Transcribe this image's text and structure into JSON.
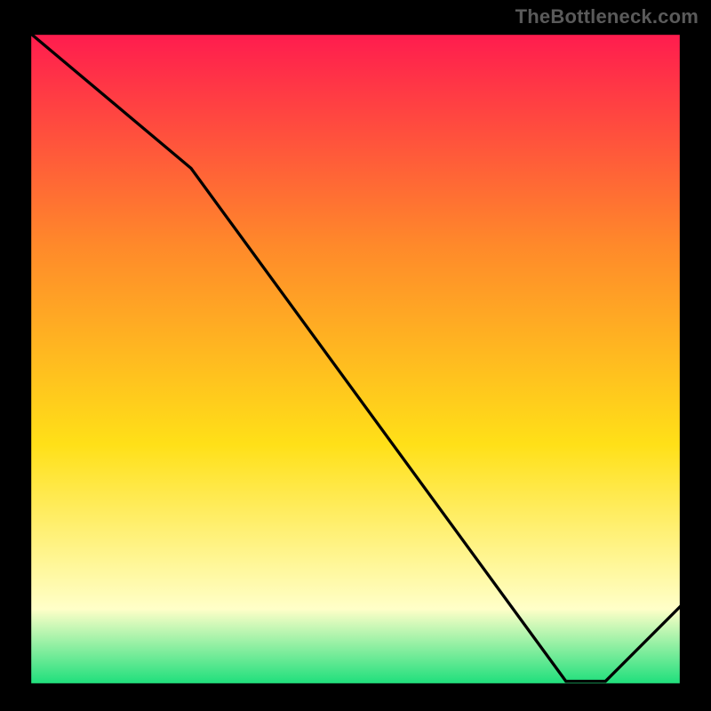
{
  "watermark": "TheBottleneck.com",
  "colors": {
    "frame": "#000000",
    "line": "#000000",
    "red_label": "#ff1a1a",
    "gradient": {
      "top": "#ff1a4f",
      "mid1": "#ff8a2a",
      "mid2": "#ffe018",
      "pale": "#ffffc8",
      "green": "#25e07e"
    }
  },
  "chart_data": {
    "type": "line",
    "title": "",
    "xlabel": "",
    "ylabel": "",
    "xlim": [
      0,
      100
    ],
    "ylim": [
      0,
      100
    ],
    "grid": false,
    "legend": false,
    "annotations": [
      {
        "x": 80,
        "y": 1,
        "text": "",
        "color": "#ff1a1a"
      }
    ],
    "series": [
      {
        "name": "curve",
        "x": [
          0,
          25,
          82,
          88,
          100
        ],
        "y": [
          100,
          79,
          1,
          1,
          13
        ]
      }
    ]
  }
}
